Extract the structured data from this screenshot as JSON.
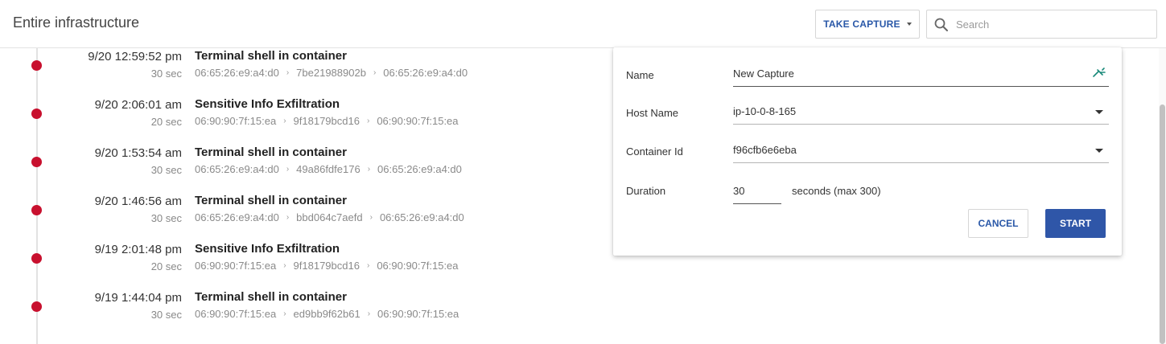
{
  "header": {
    "title": "Entire infrastructure",
    "capture_button": "TAKE CAPTURE",
    "search_placeholder": "Search"
  },
  "events": [
    {
      "time": "9/20 12:59:52 pm",
      "duration": "30 sec",
      "title": "Terminal shell in container",
      "path": [
        "06:65:26:e9:a4:d0",
        "7be21988902b",
        "06:65:26:e9:a4:d0"
      ]
    },
    {
      "time": "9/20 2:06:01 am",
      "duration": "20 sec",
      "title": "Sensitive Info Exfiltration",
      "path": [
        "06:90:90:7f:15:ea",
        "9f18179bcd16",
        "06:90:90:7f:15:ea"
      ]
    },
    {
      "time": "9/20 1:53:54 am",
      "duration": "30 sec",
      "title": "Terminal shell in container",
      "path": [
        "06:65:26:e9:a4:d0",
        "49a86fdfe176",
        "06:65:26:e9:a4:d0"
      ]
    },
    {
      "time": "9/20 1:46:56 am",
      "duration": "30 sec",
      "title": "Terminal shell in container",
      "path": [
        "06:65:26:e9:a4:d0",
        "bbd064c7aefd",
        "06:65:26:e9:a4:d0"
      ]
    },
    {
      "time": "9/19 2:01:48 pm",
      "duration": "20 sec",
      "title": "Sensitive Info Exfiltration",
      "path": [
        "06:90:90:7f:15:ea",
        "9f18179bcd16",
        "06:90:90:7f:15:ea"
      ]
    },
    {
      "time": "9/19 1:44:04 pm",
      "duration": "30 sec",
      "title": "Terminal shell in container",
      "path": [
        "06:90:90:7f:15:ea",
        "ed9bb9f62b61",
        "06:90:90:7f:15:ea"
      ]
    }
  ],
  "capture_form": {
    "name_label": "Name",
    "name_value": "New Capture",
    "host_label": "Host Name",
    "host_value": "ip-10-0-8-165",
    "container_label": "Container Id",
    "container_value": "f96cfb6e6eba",
    "duration_label": "Duration",
    "duration_value": "30",
    "duration_hint": "seconds (max 300)",
    "cancel_label": "CANCEL",
    "start_label": "START"
  },
  "colors": {
    "accent": "#2f56a8",
    "event_dot": "#c8102e",
    "pin_icon": "#1a8a7a"
  },
  "icons": {
    "search": "search-icon",
    "pin": "pin-icon",
    "dropdown": "chevron-down-icon"
  }
}
